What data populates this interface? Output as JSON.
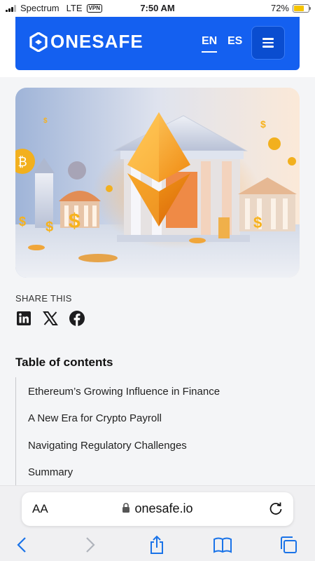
{
  "status_bar": {
    "carrier": "Spectrum",
    "network": "LTE",
    "vpn_badge": "VPN",
    "time": "7:50 AM",
    "battery_percent": "72%",
    "battery_level": 0.72
  },
  "header": {
    "brand": "ONESAFE",
    "languages": [
      "EN",
      "ES"
    ],
    "active_language": "EN",
    "menu_icon": "hamburger-icon",
    "brand_color": "#1460f0"
  },
  "share": {
    "label": "SHARE THIS",
    "icons": [
      "linkedin-icon",
      "x-icon",
      "facebook-icon"
    ]
  },
  "toc": {
    "title": "Table of contents",
    "items": [
      "Ethereum’s Growing Influence in Finance",
      "A New Era for Crypto Payroll",
      "Navigating Regulatory Challenges",
      "Summary"
    ]
  },
  "browser": {
    "text_size_button": "AA",
    "url": "onesafe.io",
    "icons": [
      "lock-icon",
      "reload-icon",
      "back-icon",
      "forward-icon",
      "share-icon",
      "bookmarks-icon",
      "tabs-icon"
    ]
  }
}
